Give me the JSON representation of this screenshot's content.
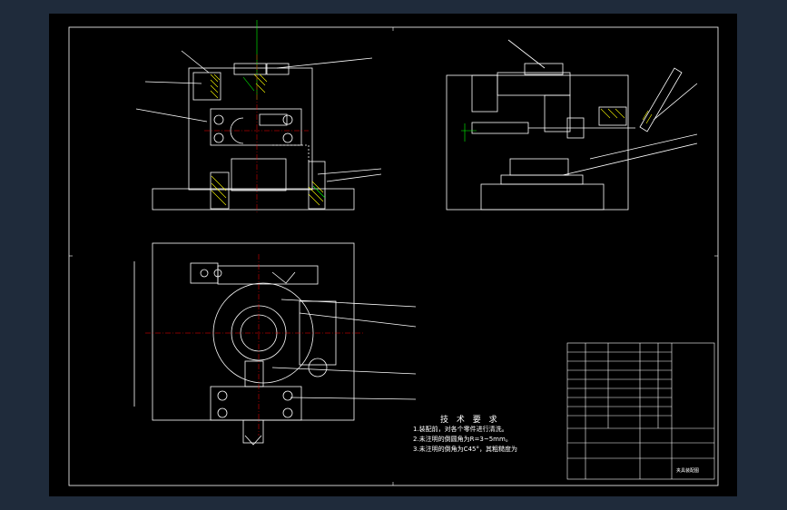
{
  "notes": {
    "title": "技 术 要 求",
    "lines": [
      "1.装配前，对各个零件进行清洗。",
      "2.未注明的倒圆角为R=3~5mm。",
      "3.未注明的倒角为C45°，其粗糙度为"
    ]
  },
  "title_block": {
    "name": "夹具装配图"
  },
  "colors": {
    "background": "#1f2b3b",
    "sheet": "#000000",
    "line": "#ffffff",
    "dim": "#00ff00",
    "hatch": "#ffff00",
    "center": "#ff0000"
  }
}
